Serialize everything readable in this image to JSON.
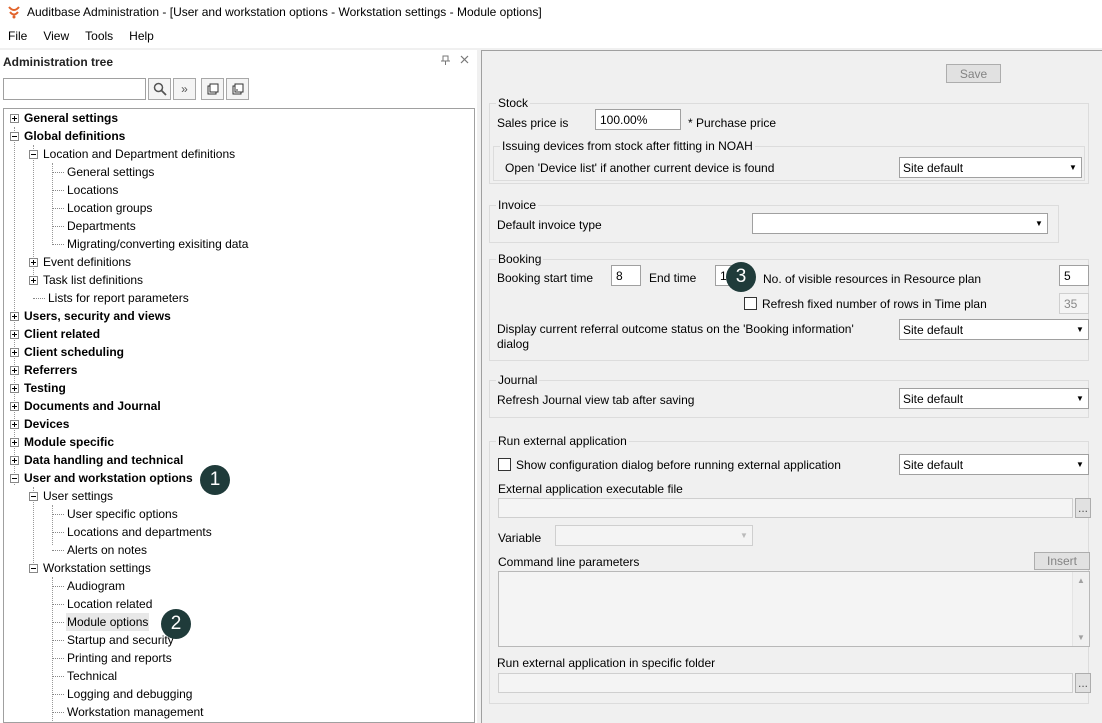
{
  "window": {
    "title": "Auditbase Administration - [User and workstation options - Workstation settings - Module options]"
  },
  "menu": [
    "File",
    "View",
    "Tools",
    "Help"
  ],
  "left_panel": {
    "title": "Administration tree",
    "search_value": "",
    "pin_glyph": "📌",
    "close_glyph": "✕"
  },
  "tree": {
    "items": [
      "General settings",
      "Global definitions",
      "Location and Department definitions",
      "General settings",
      "Locations",
      "Location groups",
      "Departments",
      "Migrating/converting exisiting data",
      "Event definitions",
      "Task list definitions",
      "Lists for report parameters",
      "Users, security and views",
      "Client related",
      "Client scheduling",
      "Referrers",
      "Testing",
      "Documents and Journal",
      "Devices",
      "Module specific",
      "Data handling and technical",
      "User and workstation options",
      "User settings",
      "User specific options",
      "Locations and departments",
      "Alerts on notes",
      "Workstation settings",
      "Audiogram",
      "Location related",
      "Module options",
      "Startup and security",
      "Printing and reports",
      "Technical",
      "Logging and debugging",
      "Workstation management"
    ]
  },
  "badges": [
    "1",
    "2",
    "3"
  ],
  "right_panel": {
    "save_label": "Save",
    "stock": {
      "title": "Stock",
      "sales_price_label": "Sales price  is",
      "sales_price_value": "100.00%",
      "purchase_price_label": "*  Purchase price",
      "issuing_title": "Issuing devices from stock after fitting in NOAH",
      "open_device_list_label": "Open 'Device list' if another current device is found",
      "open_device_list_value": "Site default"
    },
    "invoice": {
      "title": "Invoice",
      "default_type_label": "Default invoice type",
      "default_type_value": ""
    },
    "booking": {
      "title": "Booking",
      "start_time_label": "Booking start time",
      "start_time_value": "8",
      "end_time_label": "End time",
      "end_time_value": "1",
      "visible_resources_label": "No. of visible resources in Resource plan",
      "visible_resources_value": "5",
      "refresh_rows_label": "Refresh fixed number of rows in Time plan",
      "refresh_rows_value": "35",
      "referral_label": "Display current referral outcome status on the 'Booking information' dialog",
      "referral_value": "Site default"
    },
    "journal": {
      "title": "Journal",
      "refresh_label": "Refresh Journal view tab after saving",
      "refresh_value": "Site default"
    },
    "external": {
      "title": "Run external application",
      "show_config_label": "Show configuration dialog before running external application",
      "show_config_value": "Site default",
      "exe_label": "External application executable file",
      "exe_value": "",
      "browse_label": "...",
      "variable_label": "Variable",
      "variable_value": "",
      "cmd_label": "Command line parameters",
      "insert_label": "Insert",
      "folder_label": "Run external application in specific folder",
      "folder_value": "",
      "browse2_label": "..."
    }
  },
  "colors": {
    "badge": "#1f3b3a",
    "app_icon": "#e2632a"
  },
  "icons": [
    "app-logo-icon",
    "pin-icon",
    "close-icon",
    "search-icon",
    "expand-all-icon",
    "collapse-icon",
    "restore-icon"
  ]
}
